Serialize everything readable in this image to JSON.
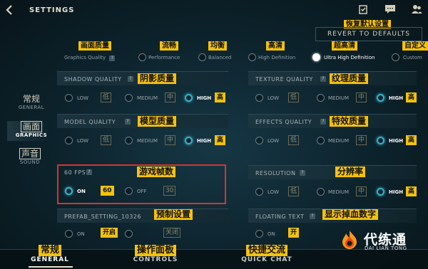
{
  "header": {
    "back_icon": "back-chevron-icon",
    "title": "SETTINGS",
    "icons": [
      "clipboard-icon",
      "chat-icon",
      "friends-icon"
    ],
    "revert_cn": "恢复默认设置",
    "revert_label": "REVERT TO DEFAULTS"
  },
  "quality": {
    "label_cn": "画面质量",
    "label_en": "Graphics Quality",
    "options": [
      {
        "cn": "流畅",
        "en": "Performance",
        "selected": false
      },
      {
        "cn": "均衡",
        "en": "Balanced",
        "selected": false
      },
      {
        "cn": "高清",
        "en": "High Definition",
        "selected": false
      },
      {
        "cn": "超高清",
        "en": "Ultra High Definition",
        "selected": true
      },
      {
        "cn": "自定义",
        "en": "Custom",
        "selected": false
      }
    ]
  },
  "nav": {
    "items": [
      {
        "cn": "常规",
        "en": "GENERAL",
        "active": false
      },
      {
        "cn": "画面",
        "en": "GRAPHICS",
        "active": true
      },
      {
        "cn": "声音",
        "en": "SOUND",
        "active": false
      }
    ]
  },
  "settings": {
    "shadow": {
      "en": "SHADOW QUALITY",
      "cn": "阴影质量",
      "low": "LOW",
      "low_cn": "低",
      "medium": "MEDIUM",
      "medium_cn": "中",
      "high": "HIGH",
      "high_cn": "高",
      "selected": "high"
    },
    "texture": {
      "en": "TEXTURE QUALITY",
      "cn": "纹理质量",
      "low": "LOW",
      "low_cn": "低",
      "medium": "MEDIUM",
      "medium_cn": "中",
      "high": "HIGH",
      "high_cn": "高",
      "selected": "high"
    },
    "model": {
      "en": "MODEL QUALITY",
      "cn": "模型质量",
      "low": "LOW",
      "low_cn": "低",
      "medium": "MEDIUM",
      "medium_cn": "中",
      "high": "HIGH",
      "high_cn": "高",
      "selected": "high"
    },
    "effects": {
      "en": "EFFECTS QUALITY",
      "cn": "特效质量",
      "low": "LOW",
      "low_cn": "低",
      "medium": "MEDIUM",
      "medium_cn": "中",
      "high": "HIGH",
      "high_cn": "高",
      "selected": "high"
    },
    "fps": {
      "en": "60 FPS",
      "cn": "游戏帧数",
      "on": "ON",
      "on_cn": "60",
      "off": "OFF",
      "off_cn": "30",
      "selected": "on"
    },
    "resolution": {
      "en": "RESOLUTION",
      "cn": "分辨率",
      "low": "LOW",
      "low_cn": "低",
      "medium": "MEDIUM",
      "medium_cn": "中",
      "high": "HIGH",
      "high_cn": "高",
      "selected": "high"
    },
    "prefab": {
      "en": "PREFAB_SETTING_10326",
      "cn": "预制设置",
      "on": "ON",
      "on_cn": "开启",
      "off_cn": "关闭",
      "selected": "none"
    },
    "floating": {
      "en": "FLOATING TEXT",
      "cn": "显示掉血数字",
      "on": "ON",
      "on_cn": "开",
      "selected": "none"
    }
  },
  "bottom_tabs": [
    {
      "cn": "常规",
      "en": "GENERAL",
      "active": true
    },
    {
      "cn": "操作面板",
      "en": "CONTROLS",
      "active": false
    },
    {
      "cn": "快捷交流",
      "en": "QUICK CHAT",
      "active": false
    }
  ],
  "watermark": {
    "text": "代练通",
    "sub": "DAI LIAN TONG"
  },
  "colors": {
    "accent": "#3ab0c9",
    "highlight_tag": "#f4c20d",
    "annotation_box": "#d6342e"
  }
}
